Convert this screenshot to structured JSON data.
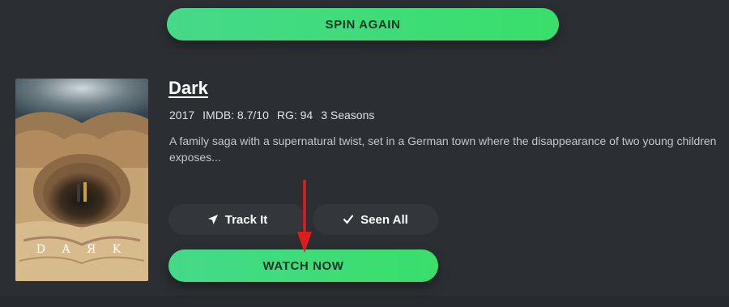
{
  "header": {
    "spin_label": "SPIN AGAIN"
  },
  "show": {
    "title": "Dark",
    "year": "2017",
    "imdb": "IMDB: 8.7/10",
    "rg": "RG: 94",
    "seasons": "3 Seasons",
    "description": "A family saga with a supernatural twist, set in a German town where the disappearance of two young children exposes...",
    "poster_text": "D A Я K"
  },
  "actions": {
    "track_label": "Track It",
    "seen_label": "Seen All",
    "watch_label": "WATCH NOW"
  },
  "colors": {
    "accent": "#3ddc72",
    "background": "#2b2f33",
    "button_dark": "#33373b",
    "annotation_arrow": "#e01b1b"
  },
  "icons": {
    "track": "location-arrow-icon",
    "seen": "checkmark-icon"
  }
}
